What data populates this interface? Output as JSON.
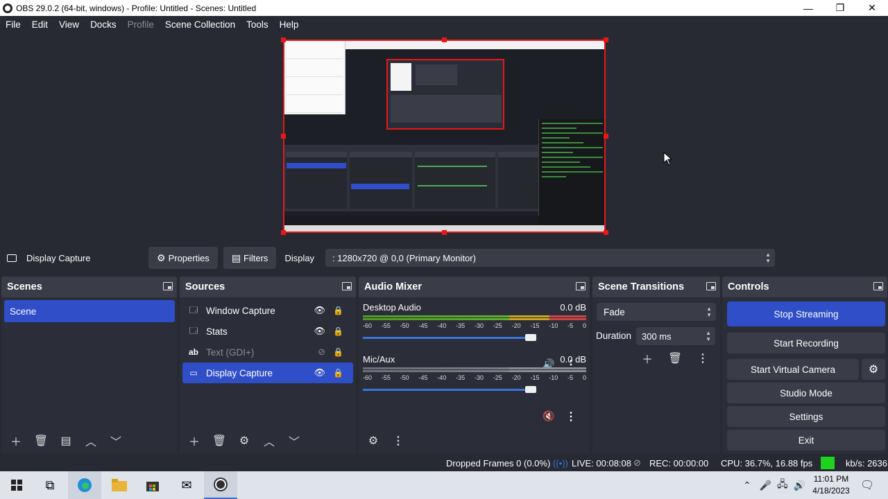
{
  "window": {
    "title": "OBS 29.0.2 (64-bit, windows) - Profile: Untitled - Scenes: Untitled",
    "minimize": "—",
    "maximize": "❐",
    "close": "✕"
  },
  "menu": [
    "File",
    "Edit",
    "View",
    "Docks",
    "Profile",
    "Scene Collection",
    "Tools",
    "Help"
  ],
  "source_toolbar": {
    "source_name": "Display Capture",
    "properties": "Properties",
    "filters": "Filters",
    "display_label": "Display",
    "display_value": ": 1280x720 @ 0,0 (Primary Monitor)"
  },
  "scenes": {
    "title": "Scenes",
    "items": [
      "Scene"
    ]
  },
  "sources": {
    "title": "Sources",
    "items": [
      {
        "label": "Window Capture",
        "icon": "window-icon",
        "visible": true
      },
      {
        "label": "Stats",
        "icon": "window-icon",
        "visible": true
      },
      {
        "label": "Text (GDI+)",
        "icon": "text-icon",
        "visible": false
      },
      {
        "label": "Display Capture",
        "icon": "monitor-icon",
        "visible": true
      }
    ]
  },
  "mixer": {
    "title": "Audio Mixer",
    "channels": [
      {
        "name": "Desktop Audio",
        "level": "0.0 dB",
        "volume": 1.0,
        "muted": false
      },
      {
        "name": "Mic/Aux",
        "level": "0.0 dB",
        "volume": 1.0,
        "muted": true
      }
    ],
    "scale": [
      "-60",
      "-55",
      "-50",
      "-45",
      "-40",
      "-35",
      "-30",
      "-25",
      "-20",
      "-15",
      "-10",
      "-5",
      "0"
    ]
  },
  "transitions": {
    "title": "Scene Transitions",
    "selected": "Fade",
    "duration_label": "Duration",
    "duration_value": "300 ms"
  },
  "controls": {
    "title": "Controls",
    "stop_streaming": "Stop Streaming",
    "start_recording": "Start Recording",
    "start_virtual_camera": "Start Virtual Camera",
    "studio_mode": "Studio Mode",
    "settings": "Settings",
    "exit": "Exit"
  },
  "status": {
    "dropped_frames": "Dropped Frames 0 (0.0%)",
    "live": "LIVE: 00:08:08",
    "rec": "REC: 00:00:00",
    "cpu": "CPU: 36.7%, 16.88 fps",
    "kbs": "kb/s: 2636"
  },
  "taskbar": {
    "time": "11:01 PM",
    "date": "4/18/2023"
  },
  "colors": {
    "accent": "#2f4ec7",
    "background": "#272a33",
    "panel": "#2b2e38",
    "selection_border": "#e81818",
    "status_ok": "#1ed31e"
  }
}
